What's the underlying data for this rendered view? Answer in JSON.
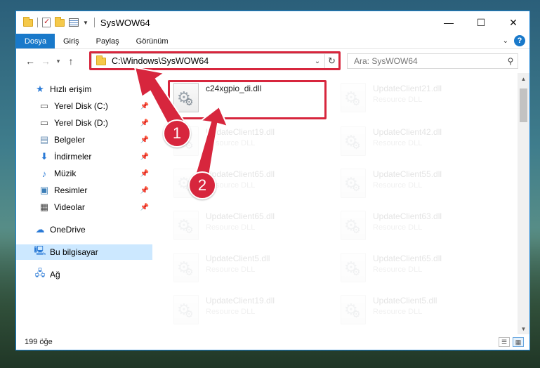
{
  "window": {
    "title": "SysWOW64"
  },
  "window_buttons": {
    "minimize": "—",
    "maximize": "☐",
    "close": "✕"
  },
  "ribbon": {
    "tabs": [
      "Dosya",
      "Giriş",
      "Paylaş",
      "Görünüm"
    ],
    "help": "?"
  },
  "address_bar": {
    "path": "C:\\Windows\\SysWOW64"
  },
  "search": {
    "placeholder": "Ara: SysWOW64"
  },
  "sidebar": {
    "items": [
      {
        "label": "Hızlı erişim",
        "icon": "star-icon",
        "pinned": false
      },
      {
        "label": "Yerel Disk (C:)",
        "icon": "drive-icon",
        "pinned": true
      },
      {
        "label": "Yerel Disk (D:)",
        "icon": "drive-icon",
        "pinned": true
      },
      {
        "label": "Belgeler",
        "icon": "documents-icon",
        "pinned": true
      },
      {
        "label": "İndirmeler",
        "icon": "download-icon",
        "pinned": true
      },
      {
        "label": "Müzik",
        "icon": "music-icon",
        "pinned": true
      },
      {
        "label": "Resimler",
        "icon": "pictures-icon",
        "pinned": true
      },
      {
        "label": "Videolar",
        "icon": "video-icon",
        "pinned": true
      },
      {
        "label": "OneDrive",
        "icon": "cloud-icon",
        "pinned": false
      },
      {
        "label": "Bu bilgisayar",
        "icon": "computer-icon",
        "pinned": false,
        "selected": true
      },
      {
        "label": "Ağ",
        "icon": "network-icon",
        "pinned": false
      }
    ]
  },
  "files": {
    "highlighted": {
      "name": "c24xgpio_di.dll",
      "type": ""
    },
    "left_column": [
      {
        "name": "UpdateClient19.dll",
        "type": "Resource DLL"
      },
      {
        "name": "UpdateClient65.dll",
        "type": "Resource DLL"
      },
      {
        "name": "UpdateClient65.dll",
        "type": "Resource DLL"
      },
      {
        "name": "UpdateClient5.dll",
        "type": "Resource DLL"
      },
      {
        "name": "UpdateClient19.dll",
        "type": "Resource DLL"
      }
    ],
    "right_column": [
      {
        "name": "UpdateClient21.dll",
        "type": "Resource DLL"
      },
      {
        "name": "UpdateClient42.dll",
        "type": "Resource DLL"
      },
      {
        "name": "UpdateClient55.dll",
        "type": "Resource DLL"
      },
      {
        "name": "UpdateClient63.dll",
        "type": "Resource DLL"
      },
      {
        "name": "UpdateClient65.dll",
        "type": "Resource DLL"
      },
      {
        "name": "UpdateClient5.dll",
        "type": "Resource DLL"
      }
    ]
  },
  "status": {
    "item_count": "199 öğe"
  },
  "markers": {
    "one": "1",
    "two": "2"
  },
  "colors": {
    "accent": "#1979ca",
    "highlight": "#d7263d",
    "selected": "#cce8ff"
  }
}
